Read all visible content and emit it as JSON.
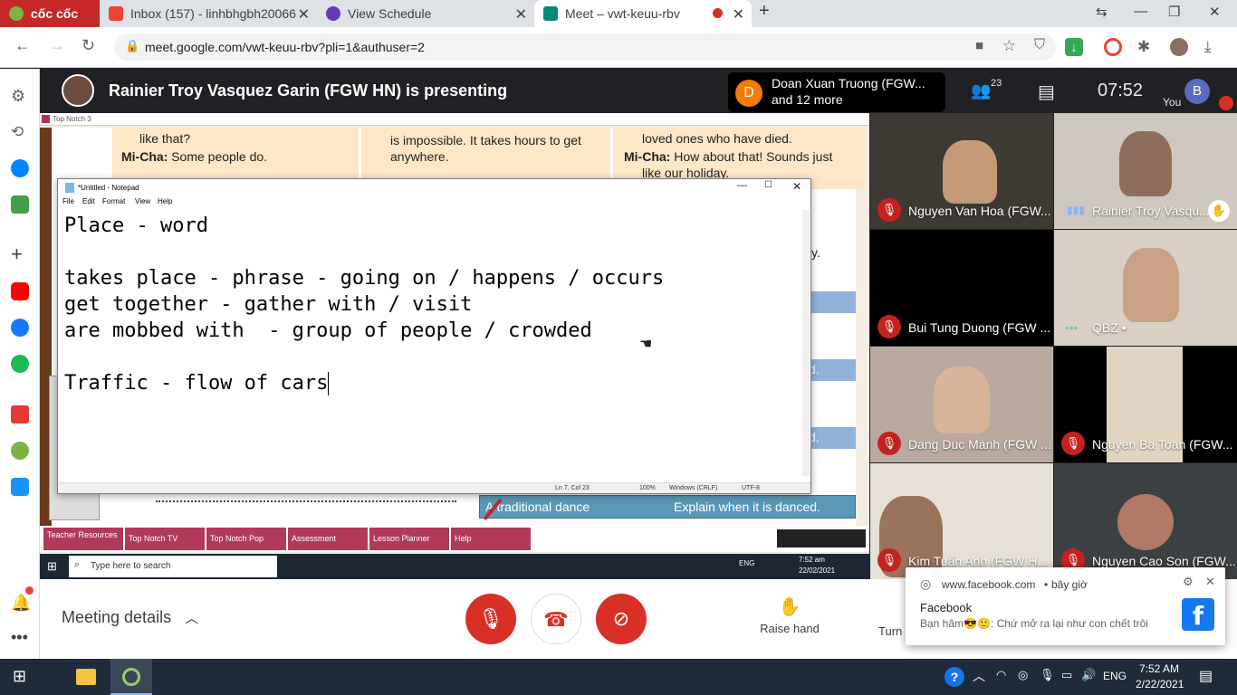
{
  "browser": {
    "tabs": [
      {
        "label": "cốc cốc"
      },
      {
        "label": "Inbox (157) - linhbhgbh20066"
      },
      {
        "label": "View Schedule"
      },
      {
        "label": "Meet – vwt-keuu-rbv"
      }
    ],
    "url": "meet.google.com/vwt-keuu-rbv?pli=1&authuser=2",
    "colors": {
      "accent": "#1a73e8"
    }
  },
  "meet": {
    "presenter_text": "Rainier Troy Vasquez Garin (FGW HN) is presenting",
    "participant_pill": {
      "avatar_letter": "D",
      "line1": "Doan Xuan Truong (FGW...",
      "line2": "and 12 more"
    },
    "people_count": "23",
    "time": "07:52",
    "you_label": "You",
    "you_avatar": "B",
    "meeting_details": "Meeting details",
    "raise_hand": "Raise hand",
    "turn_label": "Turn"
  },
  "presentation": {
    "window_title": "Top Notch 3",
    "cards": [
      {
        "l1": "like that?",
        "spk": "Mi-Cha:",
        "l2": " Some people do."
      },
      {
        "l1": "is impossible. It takes hours to get",
        "l2": "anywhere."
      },
      {
        "l1": "loved ones who have died.",
        "spk": "Mi-Cha:",
        "l2": " How about that! Sounds just",
        "l3": "like our holiday."
      }
    ],
    "side_text_y": "y.",
    "side_text_d1": "d.",
    "side_text_d2": "d.",
    "table_row_left": "A traditional dance",
    "table_row_right": "Explain when it is danced.",
    "bottom_menu": [
      "Teacher Resources",
      "Top Notch TV",
      "Top Notch Pop",
      "Assessment",
      "Lesson Planner",
      "Help"
    ],
    "win_search": "Type here to search",
    "inner_tray": {
      "lang": "ENG",
      "time": "7:52 am",
      "date": "22/02/2021"
    }
  },
  "notepad": {
    "title": "*Untitled - Notepad",
    "menu": [
      "File",
      "Edit",
      "Format",
      "View",
      "Help"
    ],
    "lines": [
      "Place - word",
      "",
      "takes place - phrase - going on / happens / occurs",
      "get together - gather with / visit",
      "are mobbed with  - group of people / crowded",
      "",
      "Traffic - flow of cars"
    ],
    "status": {
      "pos": "Ln 7, Col 23",
      "zoom": "100%",
      "eol": "Windows (CRLF)",
      "enc": "UTF-8"
    }
  },
  "participants": [
    {
      "name": "Nguyen Van Hoa (FGW...",
      "muted": true
    },
    {
      "name": "Rainier Troy Vasqu...",
      "muted": false
    },
    {
      "name": "Bui Tung Duong (FGW ...",
      "muted": true
    },
    {
      "name": "QBZ •",
      "muted": false
    },
    {
      "name": "Dang Duc Manh (FGW ...",
      "muted": true
    },
    {
      "name": "Nguyen Ba Toan (FGW...",
      "muted": true
    },
    {
      "name": "Kim Tuấn Anh (FGW H...",
      "muted": true
    },
    {
      "name": "Nguyen Cao Son (FGW...",
      "muted": true
    }
  ],
  "notification": {
    "site": "www.facebook.com",
    "when": "bây giờ",
    "title": "Facebook",
    "sender": "Bạn hâm",
    "message": ": Chứ mở ra lại như con chết trôi"
  },
  "taskbar": {
    "lang": "ENG",
    "time": "7:52 AM",
    "date": "2/22/2021"
  }
}
